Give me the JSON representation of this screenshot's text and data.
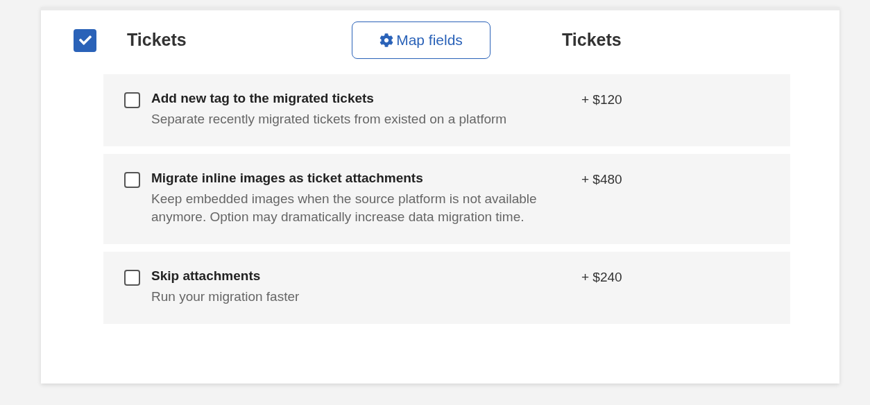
{
  "section": {
    "title": "Tickets",
    "checked": true,
    "map_button": "Map fields",
    "target_title": "Tickets"
  },
  "options": [
    {
      "title": "Add new tag to the migrated tickets",
      "description": "Separate recently migrated tickets from existed on a platform",
      "price": "+ $120",
      "checked": false
    },
    {
      "title": "Migrate inline images as ticket attachments",
      "description": "Keep embedded images when the source platform is not available anymore. Option may dramatically increase data migration time.",
      "price": "+ $480",
      "checked": false
    },
    {
      "title": "Skip attachments",
      "description": "Run your migration faster",
      "price": "+ $240",
      "checked": false
    }
  ]
}
